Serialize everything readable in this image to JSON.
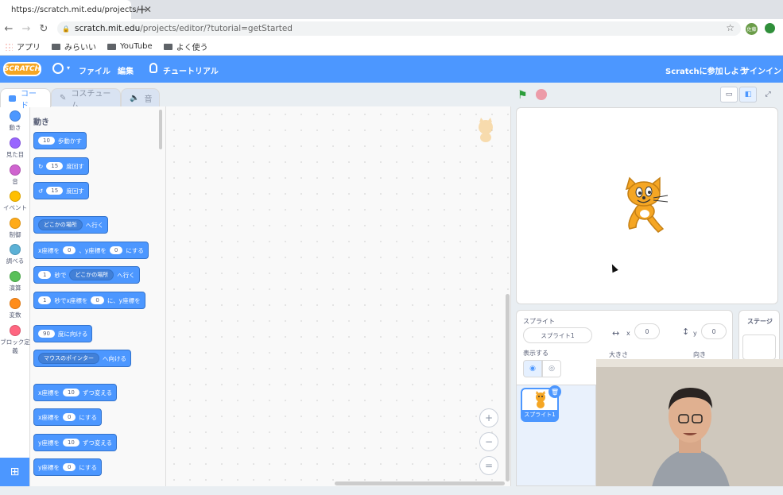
{
  "browser": {
    "tab_title": "https://scratch.mit.edu/projects/",
    "tab_close": "✕",
    "new_tab": "+",
    "url_host": "scratch.mit.edu",
    "url_path": "/projects/editor/?tutorial=getStarted",
    "bookmarks": [
      "アプリ",
      "みらいい",
      "YouTube",
      "よく使う"
    ],
    "profile_badge": "佐藤"
  },
  "menu": {
    "logo": "SCRATCH",
    "file": "ファイル",
    "edit": "編集",
    "tutorials": "チュートリアル",
    "join": "Scratchに参加しよう",
    "signin": "サインイン"
  },
  "editor_tabs": {
    "code": "コード",
    "costumes": "コスチューム",
    "sounds": "音"
  },
  "categories": [
    {
      "label": "動き",
      "color": "#4c97ff"
    },
    {
      "label": "見た目",
      "color": "#9966ff"
    },
    {
      "label": "音",
      "color": "#cf63cf"
    },
    {
      "label": "イベント",
      "color": "#ffbf00"
    },
    {
      "label": "制御",
      "color": "#ffab19"
    },
    {
      "label": "調べる",
      "color": "#5cb1d6"
    },
    {
      "label": "演算",
      "color": "#59c059"
    },
    {
      "label": "変数",
      "color": "#ff8c1a"
    },
    {
      "label": "ブロック定義",
      "color": "#ff6680"
    }
  ],
  "palette": {
    "title": "動き",
    "move": {
      "value": "10",
      "text": "歩動かす"
    },
    "turn_right": {
      "value": "15",
      "text": "度回す"
    },
    "turn_left": {
      "value": "15",
      "text": "度回す"
    },
    "goto": {
      "dropdown": "どこかの場所",
      "text": "へ行く"
    },
    "goto_xy": {
      "prefix": "x座標を",
      "x": "0",
      "mid": "、y座標を",
      "y": "0",
      "suffix": "にする"
    },
    "glide": {
      "secs": "1",
      "mid": "秒で",
      "dropdown": "どこかの場所",
      "suffix": "へ行く"
    },
    "glide_xy": {
      "secs": "1",
      "mid": "秒でx座標を",
      "x": "0",
      "suffix": "に、y座標を"
    },
    "point_dir": {
      "value": "90",
      "text": "度に向ける"
    },
    "point_towards": {
      "dropdown": "マウスのポインター",
      "text": "へ向ける"
    },
    "change_x": {
      "prefix": "x座標を",
      "value": "10",
      "suffix": "ずつ変える"
    },
    "set_x": {
      "prefix": "x座標を",
      "value": "0",
      "suffix": "にする"
    },
    "change_y": {
      "prefix": "y座標を",
      "value": "10",
      "suffix": "ずつ変える"
    },
    "set_y": {
      "prefix": "y座標を",
      "value": "0",
      "suffix": "にする"
    }
  },
  "zoom": {
    "in": "+",
    "out": "−",
    "reset": "="
  },
  "sprite_info": {
    "sprite_label": "スプライト",
    "sprite_name": "スプライト1",
    "x_label": "x",
    "x_value": "0",
    "y_label": "y",
    "y_value": "0",
    "show_label": "表示する",
    "size_label": "大きさ",
    "direction_label": "向き"
  },
  "sprite_list": {
    "sprite1": "スプライト1"
  },
  "stage_pane": {
    "title": "ステージ"
  }
}
